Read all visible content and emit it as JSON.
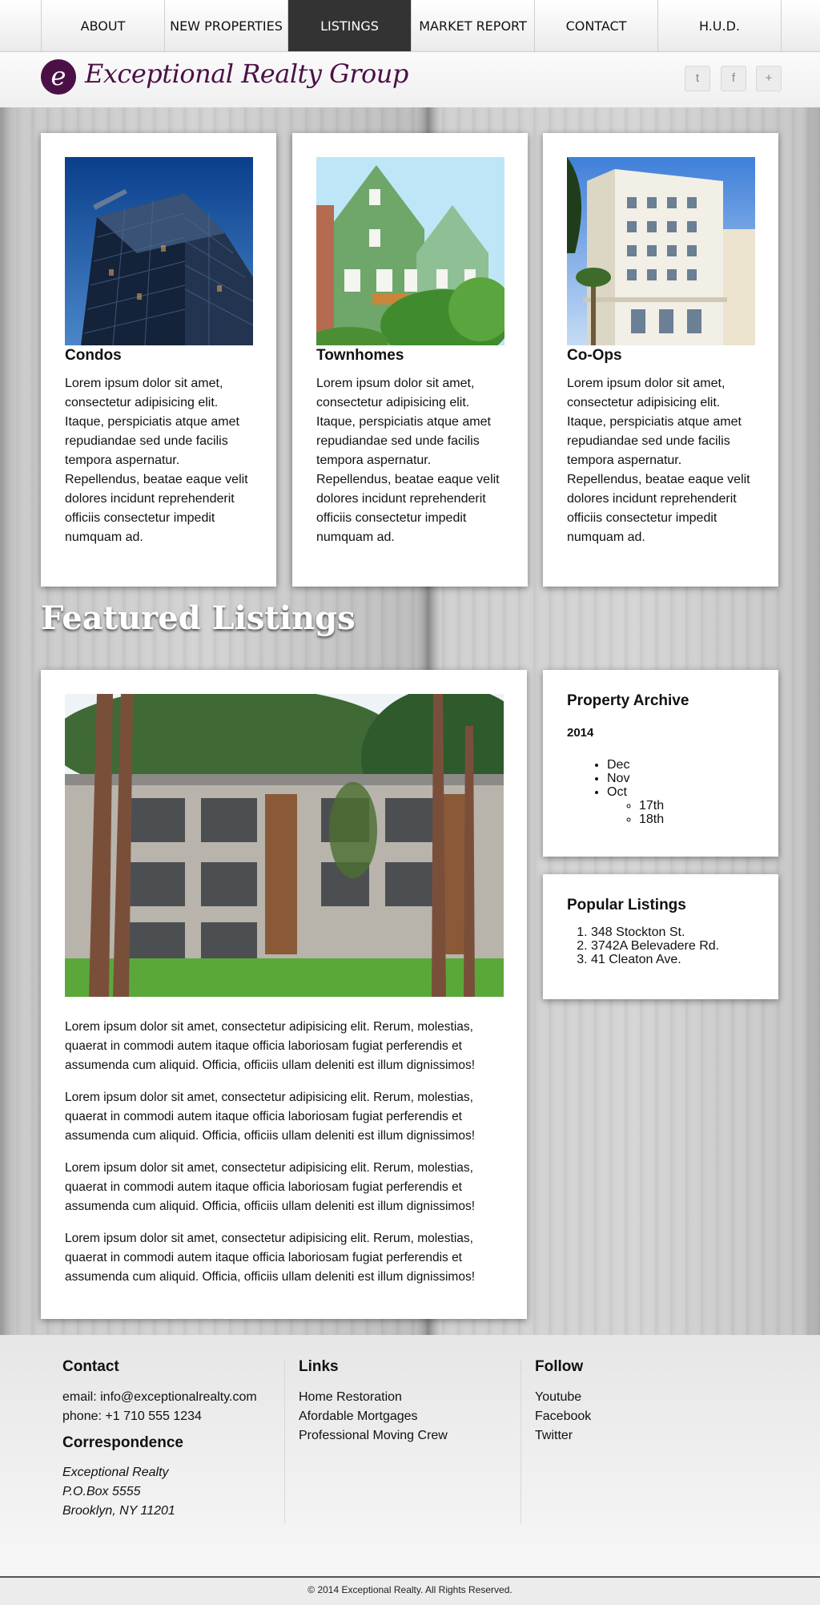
{
  "nav": {
    "items": [
      {
        "label": "ABOUT"
      },
      {
        "label": "NEW PROPERTIES"
      },
      {
        "label": "LISTINGS"
      },
      {
        "label": "MARKET REPORT"
      },
      {
        "label": "CONTACT"
      },
      {
        "label": "H.U.D."
      }
    ],
    "active": "LISTINGS"
  },
  "brand": {
    "logo_letter": "e",
    "name": "Exceptional Realty Group",
    "color": "#4b1046"
  },
  "social": {
    "twitter_glyph": "t",
    "facebook_glyph": "f",
    "plus_glyph": "+"
  },
  "property_types": [
    {
      "title": "Condos",
      "image": "glass-tower-photo",
      "text": "Lorem ipsum dolor sit amet, consectetur adipisicing elit. Itaque, perspiciatis atque amet repudiandae sed unde facilis tempora aspernatur. Repellendus, beatae eaque velit dolores incidunt reprehenderit officiis consectetur impedit numquam ad."
    },
    {
      "title": "Townhomes",
      "image": "green-townhouses-photo",
      "text": "Lorem ipsum dolor sit amet, consectetur adipisicing elit. Itaque, perspiciatis atque amet repudiandae sed unde facilis tempora aspernatur. Repellendus, beatae eaque velit dolores incidunt reprehenderit officiis consectetur impedit numquam ad."
    },
    {
      "title": "Co-Ops",
      "image": "white-apartment-building-photo",
      "text": "Lorem ipsum dolor sit amet, consectetur adipisicing elit. Itaque, perspiciatis atque amet repudiandae sed unde facilis tempora aspernatur. Repellendus, beatae eaque velit dolores incidunt reprehenderit officiis consectetur impedit numquam ad."
    }
  ],
  "featured": {
    "heading": "Featured Listings",
    "image": "apartment-among-pines-photo",
    "paragraphs": [
      "Lorem ipsum dolor sit amet, consectetur adipisicing elit. Rerum, molestias, quaerat in commodi autem itaque officia laboriosam fugiat perferendis et assumenda cum aliquid. Officia, officiis ullam deleniti est illum dignissimos!",
      "Lorem ipsum dolor sit amet, consectetur adipisicing elit. Rerum, molestias, quaerat in commodi autem itaque officia laboriosam fugiat perferendis et assumenda cum aliquid. Officia, officiis ullam deleniti est illum dignissimos!",
      "Lorem ipsum dolor sit amet, consectetur adipisicing elit. Rerum, molestias, quaerat in commodi autem itaque officia laboriosam fugiat perferendis et assumenda cum aliquid. Officia, officiis ullam deleniti est illum dignissimos!",
      "Lorem ipsum dolor sit amet, consectetur adipisicing elit. Rerum, molestias, quaerat in commodi autem itaque officia laboriosam fugiat perferendis et assumenda cum aliquid. Officia, officiis ullam deleniti est illum dignissimos!"
    ]
  },
  "archive": {
    "title": "Property Archive",
    "year": "2014",
    "months": [
      "Dec",
      "Nov",
      "Oct"
    ],
    "oct_days": [
      "17th",
      "18th"
    ]
  },
  "popular": {
    "title": "Popular Listings",
    "items": [
      "348 Stockton St.",
      "3742A Belevadere Rd.",
      "41 Cleaton Ave."
    ]
  },
  "footer": {
    "contact": {
      "title": "Contact",
      "email": "email: info@exceptionalrealty.com",
      "phone": "phone: +1 710 555 1234"
    },
    "correspondence": {
      "title": "Correspondence",
      "lines": [
        "Exceptional Realty",
        "P.O.Box 5555",
        "Brooklyn, NY 11201"
      ]
    },
    "links": {
      "title": "Links",
      "items": [
        "Home Restoration",
        "Afordable Mortgages",
        "Professional Moving Crew"
      ]
    },
    "follow": {
      "title": "Follow",
      "items": [
        "Youtube",
        "Facebook",
        "Twitter"
      ]
    },
    "copyright": "© 2014 Exceptional Realty. All Rights Reserved."
  }
}
